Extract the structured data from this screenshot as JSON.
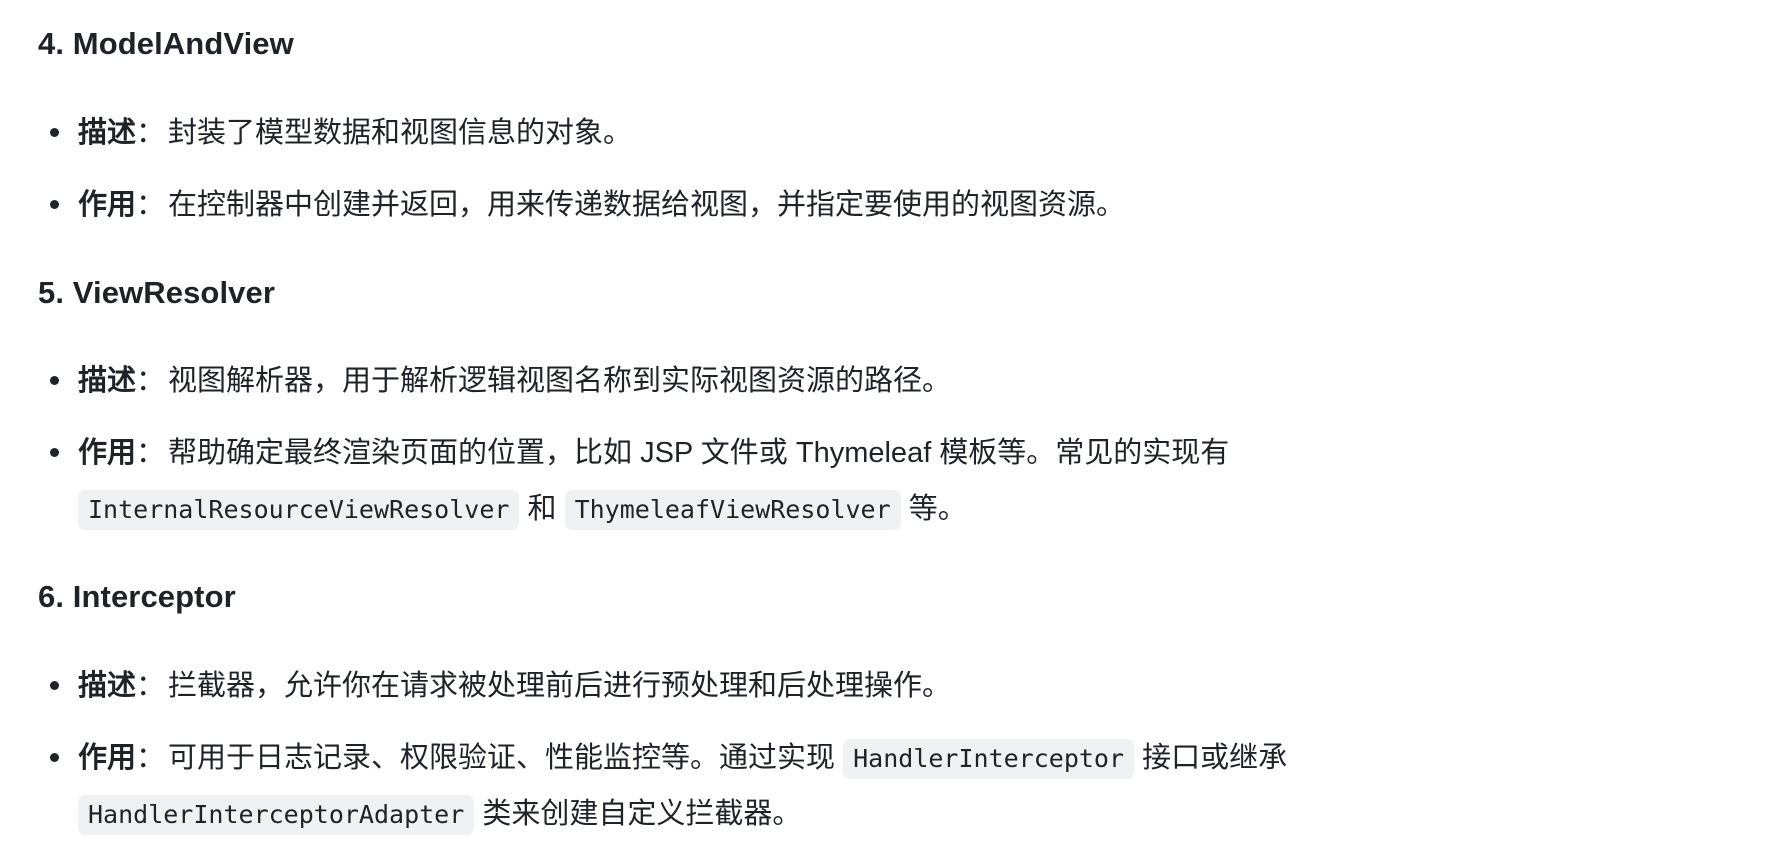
{
  "sections": [
    {
      "heading": "4. ModelAndView",
      "items": [
        {
          "term": "描述",
          "colon": "：",
          "text": "封装了模型数据和视图信息的对象。"
        },
        {
          "term": "作用",
          "colon": "：",
          "text": "在控制器中创建并返回，用来传递数据给视图，并指定要使用的视图资源。"
        }
      ]
    },
    {
      "heading": "5. ViewResolver",
      "items": [
        {
          "term": "描述",
          "colon": "：",
          "text": "视图解析器，用于解析逻辑视图名称到实际视图资源的路径。"
        },
        {
          "term": "作用",
          "colon": "：",
          "text": "帮助确定最终渲染页面的位置，比如 JSP 文件或 Thymeleaf 模板等。常见的实现有",
          "code1": "InternalResourceViewResolver",
          "mid": "和",
          "code2": "ThymeleafViewResolver",
          "tail": "等。"
        }
      ]
    },
    {
      "heading": "6. Interceptor",
      "items": [
        {
          "term": "描述",
          "colon": "：",
          "text": "拦截器，允许你在请求被处理前后进行预处理和后处理操作。"
        },
        {
          "term": "作用",
          "colon": "：",
          "text": "可用于日志记录、权限验证、性能监控等。通过实现",
          "code1": "HandlerInterceptor",
          "mid": "接口或继承",
          "code2": "HandlerInterceptorAdapter",
          "tail": "类来创建自定义拦截器。"
        }
      ]
    }
  ]
}
